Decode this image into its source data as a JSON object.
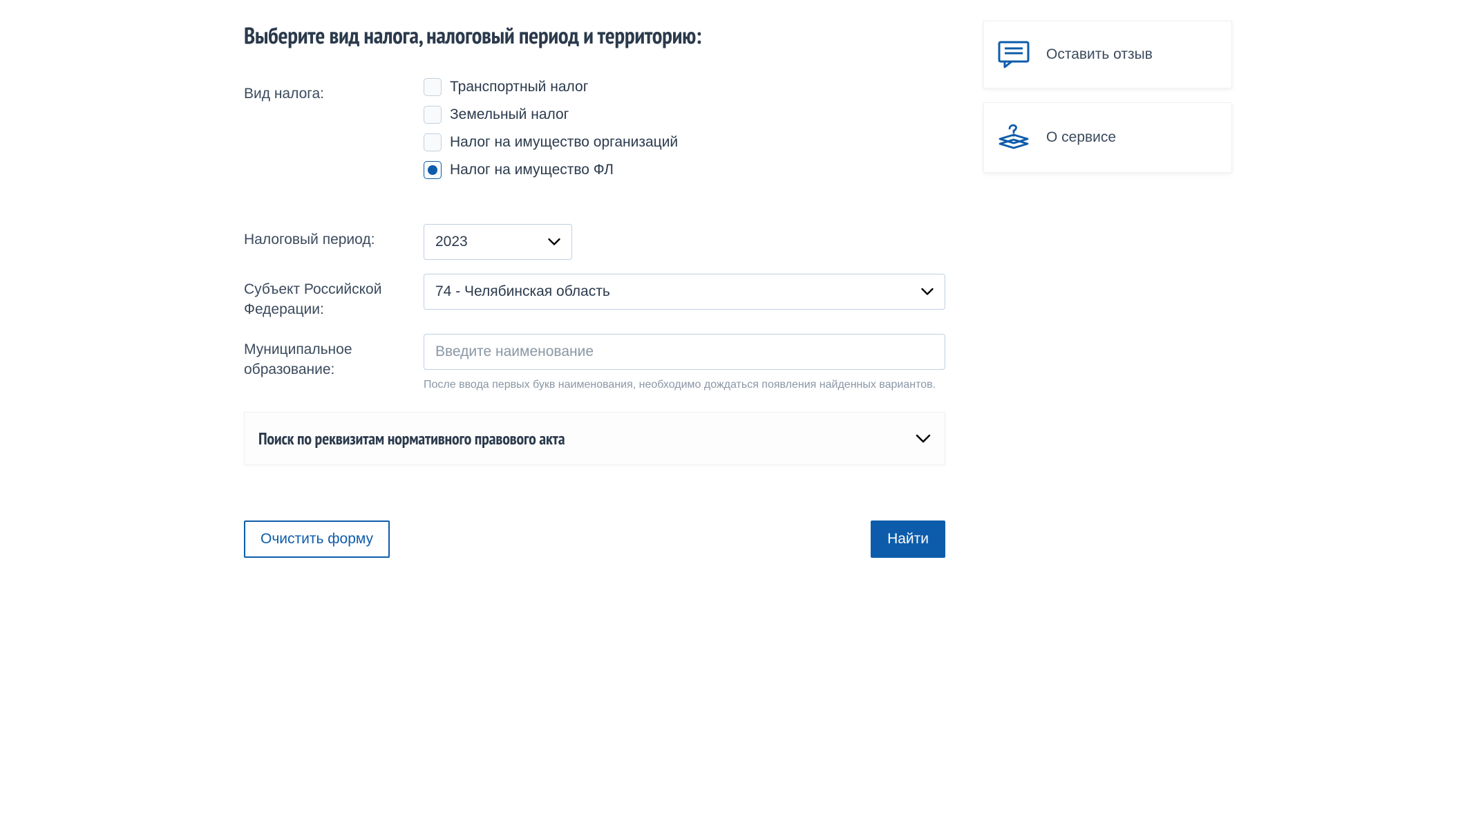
{
  "header": {
    "title": "Выберите вид налога, налоговый период и территорию:"
  },
  "labels": {
    "tax_type": "Вид налога:",
    "period": "Налоговый период:",
    "region": "Субъект Российской Федерации:",
    "municipality": "Муниципальное образование:"
  },
  "tax_types": [
    {
      "label": "Транспортный налог",
      "selected": false
    },
    {
      "label": "Земельный налог",
      "selected": false
    },
    {
      "label": "Налог на имущество организаций",
      "selected": false
    },
    {
      "label": "Налог на имущество ФЛ",
      "selected": true
    }
  ],
  "period": {
    "value": "2023"
  },
  "region": {
    "value": "74 - Челябинская область"
  },
  "municipality": {
    "placeholder": "Введите наименование",
    "hint": "После ввода первых букв наименования, необходимо дождаться появления найденных вариантов."
  },
  "accordion": {
    "title": "Поиск по реквизитам нормативного правового акта"
  },
  "actions": {
    "clear": "Очистить форму",
    "submit": "Найти"
  },
  "sidebar": {
    "feedback": "Оставить отзыв",
    "about": "О сервисе"
  },
  "colors": {
    "primary": "#0d5cab",
    "text": "#2b3a4c",
    "border": "#bfd0e0",
    "muted": "#8a97a5"
  }
}
